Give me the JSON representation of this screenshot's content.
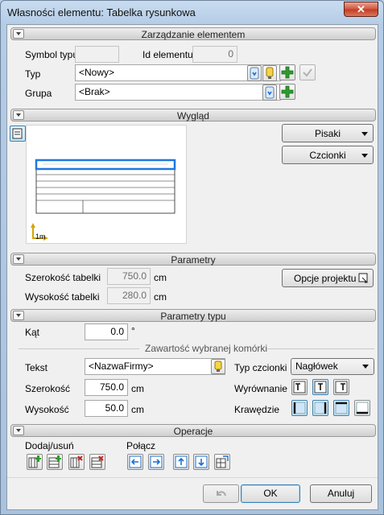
{
  "window": {
    "title": "Własności elementu: Tabelka rysunkowa",
    "close_label": "✕"
  },
  "sections": {
    "element_management": "Zarządzanie elementem",
    "appearance": "Wygląd",
    "parameters": "Parametry",
    "type_parameters": "Parametry typu",
    "operations": "Operacje"
  },
  "element": {
    "symbol_label": "Symbol typu",
    "symbol_value": "",
    "id_label": "Id elementu",
    "id_value": "0",
    "type_label": "Typ",
    "type_value": "<Nowy>",
    "group_label": "Grupa",
    "group_value": "<Brak>"
  },
  "appearance": {
    "pens_label": "Pisaki",
    "fonts_label": "Czcionki",
    "scale_label": "1m"
  },
  "parameters": {
    "width_label": "Szerokość tabelki",
    "width_value": "750.0",
    "width_unit": "cm",
    "height_label": "Wysokość tabelki",
    "height_value": "280.0",
    "height_unit": "cm",
    "project_options_label": "Opcje projektu"
  },
  "type_params": {
    "angle_label": "Kąt",
    "angle_value": "0.0",
    "angle_unit": "°",
    "cell_content_label": "Zawartość wybranej komórki",
    "text_label": "Tekst",
    "text_value": "<NazwaFirmy>",
    "cell_width_label": "Szerokość",
    "cell_width_value": "750.0",
    "cell_width_unit": "cm",
    "cell_height_label": "Wysokość",
    "cell_height_value": "50.0",
    "cell_height_unit": "cm",
    "font_type_label": "Typ czcionki",
    "font_type_value": "Nagłówek",
    "align_label": "Wyrównanie",
    "edges_label": "Krawędzie"
  },
  "operations": {
    "add_remove_label": "Dodaj/usuń",
    "merge_label": "Połącz"
  },
  "footer": {
    "ok_label": "OK",
    "cancel_label": "Anuluj"
  },
  "colors": {
    "accent_green": "#2e9b2e",
    "accent_blue": "#1e6fd0",
    "delete_red": "#c8261e",
    "scale_yellow": "#d8a400"
  }
}
